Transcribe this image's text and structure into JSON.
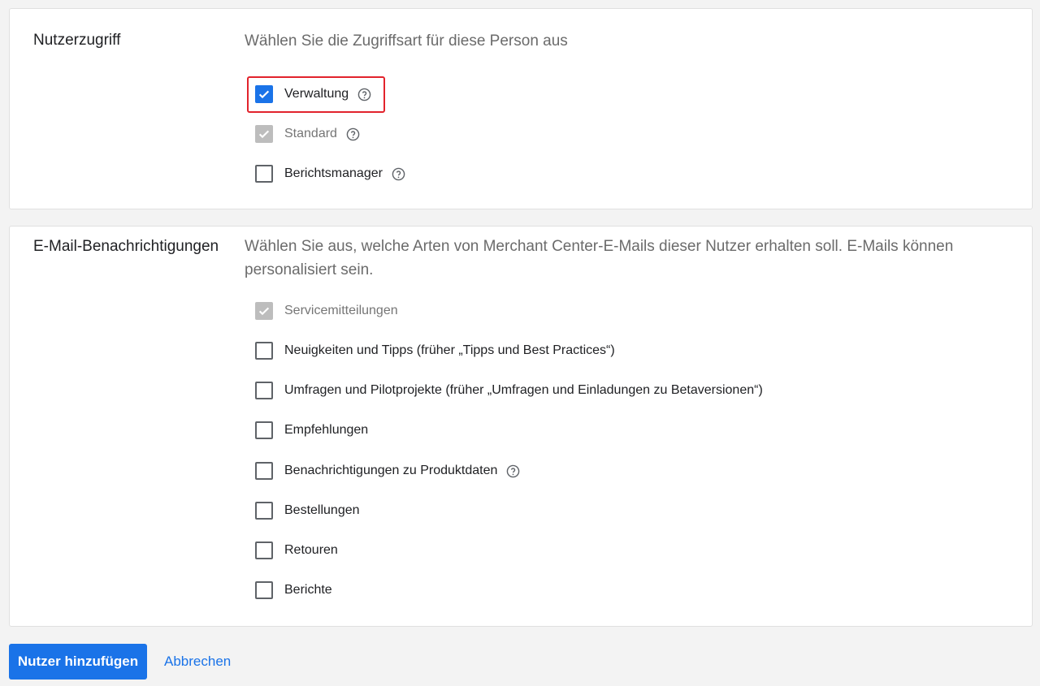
{
  "access": {
    "title": "Nutzerzugriff",
    "description": "Wählen Sie die Zugriffsart für diese Person aus",
    "options": [
      {
        "label": "Verwaltung",
        "state": "checked",
        "help": true
      },
      {
        "label": "Standard",
        "state": "checked-disabled",
        "help": true
      },
      {
        "label": "Berichtsmanager",
        "state": "unchecked",
        "help": true
      }
    ]
  },
  "email": {
    "title": "E-Mail-Benachrichtigungen",
    "description": "Wählen Sie aus, welche Arten von Merchant Center-E-Mails dieser Nutzer erhalten soll. E-Mails können personalisiert sein.",
    "options": [
      {
        "label": "Servicemitteilungen",
        "state": "checked-disabled",
        "help": false
      },
      {
        "label": "Neuigkeiten und Tipps (früher „Tipps und Best Practices“)",
        "state": "unchecked",
        "help": false
      },
      {
        "label": "Umfragen und Pilotprojekte (früher „Umfragen und Einladungen zu Betaversionen“)",
        "state": "unchecked",
        "help": false
      },
      {
        "label": "Empfehlungen",
        "state": "unchecked",
        "help": false
      },
      {
        "label": "Benachrichtigungen zu Produktdaten",
        "state": "unchecked",
        "help": true
      },
      {
        "label": "Bestellungen",
        "state": "unchecked",
        "help": false
      },
      {
        "label": "Retouren",
        "state": "unchecked",
        "help": false
      },
      {
        "label": "Berichte",
        "state": "unchecked",
        "help": false
      }
    ]
  },
  "actions": {
    "primary_label": "Nutzer hinzufügen",
    "cancel_label": "Abbrechen"
  },
  "colors": {
    "accent": "#1a73e8",
    "highlight": "#e2232c",
    "disabled": "#bdbdbd"
  },
  "icons": {
    "check": "checkmark-icon",
    "help": "help-circle-icon"
  }
}
